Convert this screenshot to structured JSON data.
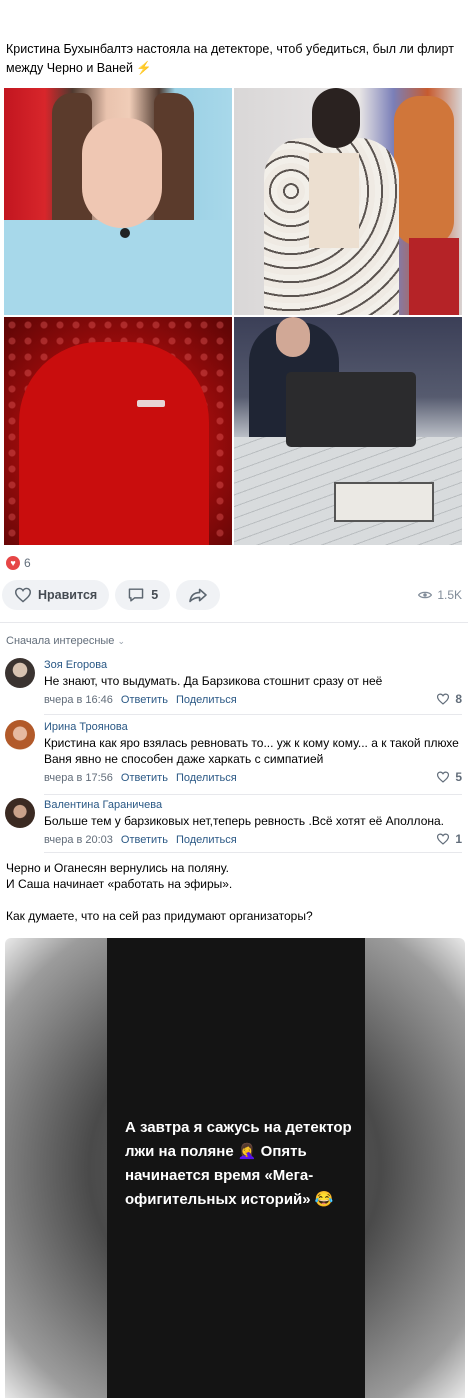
{
  "post": {
    "text": "Кристина Бухынбалтэ настояла на детекторе, чтоб убедиться, был ли флирт между Черно и Ваней ⚡"
  },
  "reactions": {
    "likes_count": "6",
    "like_button_label": "Нравится",
    "comments_count": "5",
    "views_count": "1.5K"
  },
  "comments_section": {
    "sort_label": "Сначала интересные",
    "comments": [
      {
        "author": "Зоя Егорова",
        "text": "Не знают, что выдумать. Да Барзикова стошнит сразу от неё",
        "time": "вчера в 16:46",
        "reply_label": "Ответить",
        "share_label": "Поделиться",
        "likes": "8"
      },
      {
        "author": "Ирина Троянова",
        "text": "Кристина как яро взялась ревновать то... уж к кому кому... а к такой плюхе Ваня явно не способен даже харкать с симпатией",
        "time": "вчера в 17:56",
        "reply_label": "Ответить",
        "share_label": "Поделиться",
        "likes": "5"
      },
      {
        "author": "Валентина Гараничева",
        "text": "Больше тем у барзиковых нет,теперь ревность .Всё хотят её Аполлона.",
        "time": "вчера в 20:03",
        "reply_label": "Ответить",
        "share_label": "Поделиться",
        "likes": "1"
      }
    ]
  },
  "post2": {
    "line1": "Черно и Оганесян вернулись на поляну.",
    "line2": "И Саша начинает «работать на эфиры».",
    "line3": "Как думаете, что на сей раз придумают организаторы?"
  },
  "story": {
    "text": "А завтра я сажусь на детектор лжи на поляне 🤦‍♀️ Опять начинается время «Мега-офигительных историй» 😂"
  },
  "colors": {
    "link": "#2a5885",
    "secondary": "#626d7a",
    "pill_bg": "#f0f2f5",
    "like_red": "#e64646"
  }
}
